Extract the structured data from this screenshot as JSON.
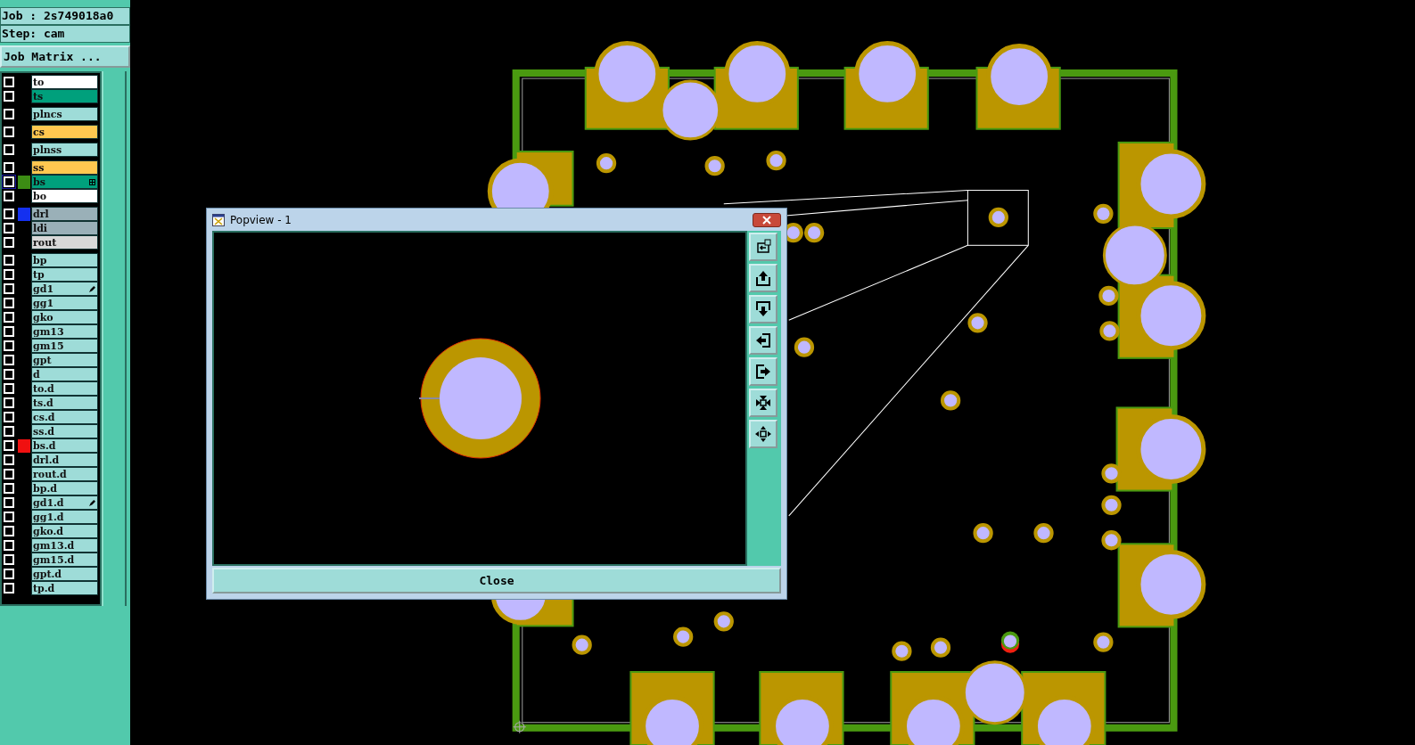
{
  "header": {
    "job": "Job : 2s749018a0",
    "step": "Step: cam",
    "matrix_button": "Job Matrix ..."
  },
  "layer_groups": [
    {
      "layers": [
        {
          "name": "to",
          "kind": "plain",
          "color": "#ffffff",
          "checked": false,
          "selected": false
        },
        {
          "name": "ts",
          "kind": "plain",
          "color": "#00a07c",
          "checked": false,
          "selected": false
        }
      ]
    },
    {
      "layers": [
        {
          "name": "plncs",
          "kind": "plain",
          "color": "#9edcd8",
          "checked": false,
          "selected": false
        }
      ]
    },
    {
      "layers": [
        {
          "name": "cs",
          "kind": "plain",
          "color": "#ffc850",
          "checked": false,
          "selected": false
        }
      ]
    },
    {
      "layers": [
        {
          "name": "plnss",
          "kind": "plain",
          "color": "#9edcd8",
          "checked": false,
          "selected": false
        }
      ]
    },
    {
      "layers": [
        {
          "name": "ss",
          "kind": "plain",
          "color": "#ffc850",
          "checked": false,
          "selected": false
        },
        {
          "name": "bs",
          "kind": "grid",
          "color": "#00a07c",
          "checked": false,
          "selected": true,
          "swatch": {
            "color": "#3c8c14"
          }
        },
        {
          "name": "bo",
          "kind": "plain",
          "color": "#ffffff",
          "checked": false,
          "selected": false
        }
      ]
    },
    {
      "layers": [
        {
          "name": "drl",
          "kind": "plain",
          "color": "#9ab0b8",
          "checked": false,
          "selected": false,
          "swatch": {
            "color": "#1430f0"
          }
        },
        {
          "name": "ldi",
          "kind": "plain",
          "color": "#9ab0b8",
          "checked": false,
          "selected": false
        },
        {
          "name": "rout",
          "kind": "plain",
          "color": "#d8d8d8",
          "checked": false,
          "selected": false
        }
      ]
    },
    {
      "layers": [
        {
          "name": "bp",
          "kind": "plain",
          "color": "#9edcd8",
          "checked": false,
          "selected": false
        },
        {
          "name": "tp",
          "kind": "plain",
          "color": "#9edcd8",
          "checked": false,
          "selected": false
        },
        {
          "name": "gd1",
          "kind": "pen",
          "color": "#9edcd8",
          "checked": false,
          "selected": false
        },
        {
          "name": "gg1",
          "kind": "plain",
          "color": "#9edcd8",
          "checked": false,
          "selected": false
        },
        {
          "name": "gko",
          "kind": "plain",
          "color": "#9edcd8",
          "checked": false,
          "selected": false
        },
        {
          "name": "gm13",
          "kind": "plain",
          "color": "#9edcd8",
          "checked": false,
          "selected": false
        },
        {
          "name": "gm15",
          "kind": "plain",
          "color": "#9edcd8",
          "checked": false,
          "selected": false
        },
        {
          "name": "gpt",
          "kind": "plain",
          "color": "#9edcd8",
          "checked": false,
          "selected": false
        },
        {
          "name": "d",
          "kind": "plain",
          "color": "#9edcd8",
          "checked": false,
          "selected": false
        },
        {
          "name": "to.d",
          "kind": "plain",
          "color": "#9edcd8",
          "checked": false,
          "selected": false
        },
        {
          "name": "ts.d",
          "kind": "plain",
          "color": "#9edcd8",
          "checked": false,
          "selected": false
        },
        {
          "name": "cs.d",
          "kind": "plain",
          "color": "#9edcd8",
          "checked": false,
          "selected": false
        },
        {
          "name": "ss.d",
          "kind": "plain",
          "color": "#9edcd8",
          "checked": false,
          "selected": false
        },
        {
          "name": "bs.d",
          "kind": "plain",
          "color": "#9edcd8",
          "checked": false,
          "selected": false,
          "swatch": {
            "color": "#f01010"
          }
        },
        {
          "name": "drl.d",
          "kind": "plain",
          "color": "#9edcd8",
          "checked": false,
          "selected": false
        },
        {
          "name": "rout.d",
          "kind": "plain",
          "color": "#9edcd8",
          "checked": false,
          "selected": false
        },
        {
          "name": "bp.d",
          "kind": "plain",
          "color": "#9edcd8",
          "checked": false,
          "selected": false
        },
        {
          "name": "gd1.d",
          "kind": "pen",
          "color": "#9edcd8",
          "checked": false,
          "selected": false
        },
        {
          "name": "gg1.d",
          "kind": "plain",
          "color": "#9edcd8",
          "checked": false,
          "selected": false
        },
        {
          "name": "gko.d",
          "kind": "plain",
          "color": "#9edcd8",
          "checked": false,
          "selected": false
        },
        {
          "name": "gm13.d",
          "kind": "plain",
          "color": "#9edcd8",
          "checked": false,
          "selected": false
        },
        {
          "name": "gm15.d",
          "kind": "plain",
          "color": "#9edcd8",
          "checked": false,
          "selected": false
        },
        {
          "name": "gpt.d",
          "kind": "plain",
          "color": "#9edcd8",
          "checked": false,
          "selected": false
        },
        {
          "name": "tp.d",
          "kind": "plain",
          "color": "#9edcd8",
          "checked": false,
          "selected": false
        }
      ]
    }
  ],
  "popview": {
    "title": "Popview - 1",
    "close_button": "Close"
  }
}
